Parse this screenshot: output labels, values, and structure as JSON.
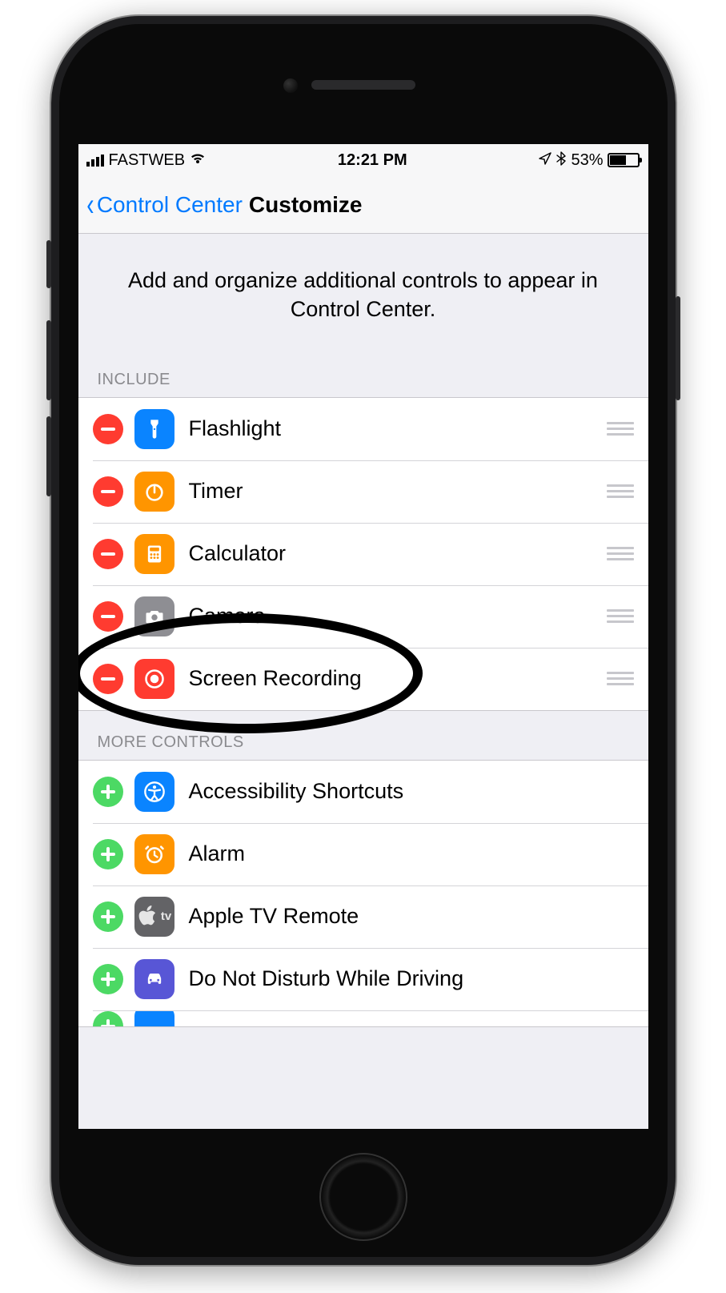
{
  "status": {
    "carrier": "FASTWEB",
    "time": "12:21 PM",
    "battery_pct": "53%"
  },
  "nav": {
    "back_label": "Control Center",
    "title": "Customize"
  },
  "description": "Add and organize additional controls to appear in Control Center.",
  "sections": {
    "include_header": "INCLUDE",
    "more_header": "MORE CONTROLS"
  },
  "include": [
    {
      "label": "Flashlight",
      "icon": "flashlight",
      "color": "blue"
    },
    {
      "label": "Timer",
      "icon": "timer",
      "color": "orange"
    },
    {
      "label": "Calculator",
      "icon": "calculator",
      "color": "orange"
    },
    {
      "label": "Camera",
      "icon": "camera",
      "color": "gray"
    },
    {
      "label": "Screen Recording",
      "icon": "record",
      "color": "red"
    }
  ],
  "more": [
    {
      "label": "Accessibility Shortcuts",
      "icon": "accessibility",
      "color": "blue"
    },
    {
      "label": "Alarm",
      "icon": "alarm",
      "color": "orange"
    },
    {
      "label": "Apple TV Remote",
      "icon": "appletv",
      "color": "darkgray"
    },
    {
      "label": "Do Not Disturb While Driving",
      "icon": "car",
      "color": "purple"
    }
  ],
  "annotation": {
    "highlighted_item": "Screen Recording"
  }
}
